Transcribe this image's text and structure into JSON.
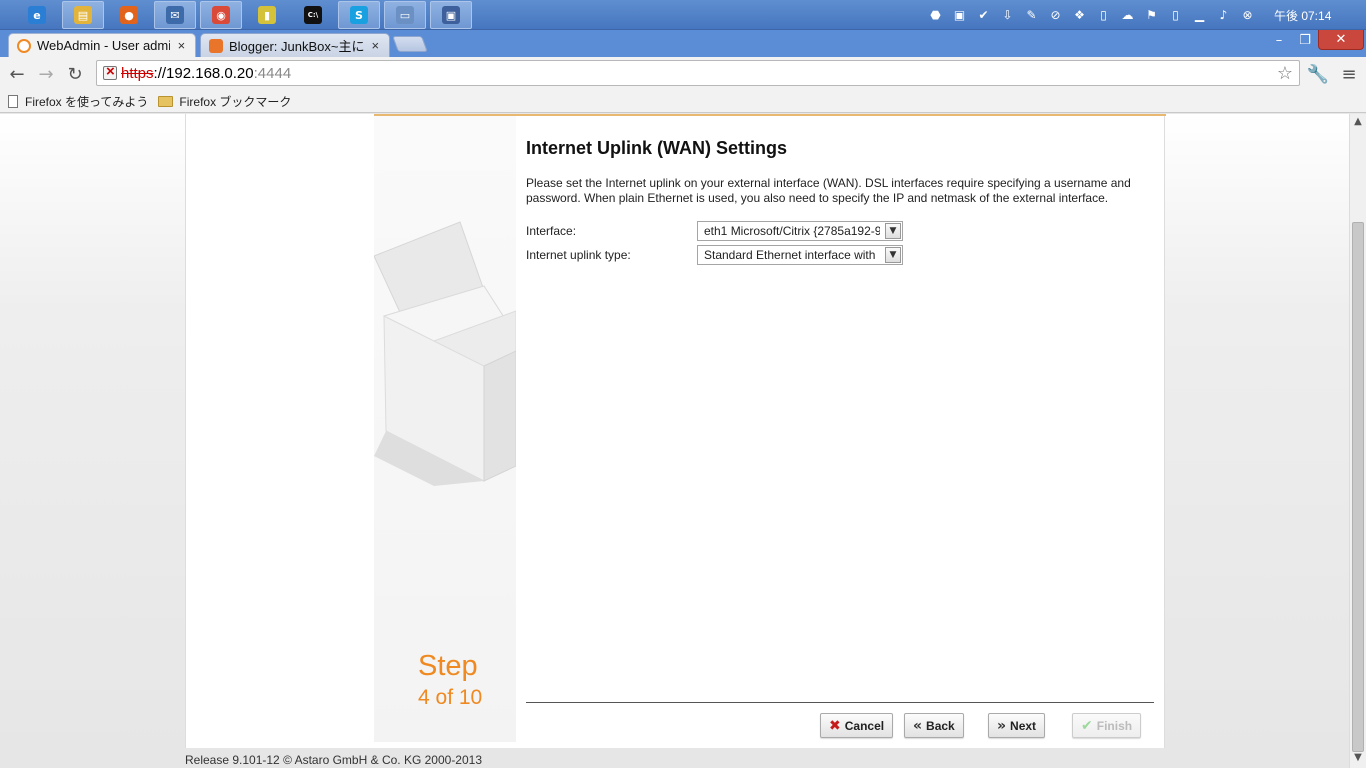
{
  "taskbar": {
    "apps": [
      {
        "name": "ie-icon",
        "glyph": "e",
        "color": "#2a7fd4"
      },
      {
        "name": "file-explorer-icon",
        "glyph": "▤",
        "color": "#e3b43c"
      },
      {
        "name": "firefox-icon",
        "glyph": "●",
        "color": "#e2631b"
      },
      {
        "name": "thunderbird-icon",
        "glyph": "✉",
        "color": "#3d6aa8"
      },
      {
        "name": "chrome-icon",
        "glyph": "◉",
        "color": "#d94a38"
      },
      {
        "name": "notes-icon",
        "glyph": "▮",
        "color": "#d4c23a"
      },
      {
        "name": "cmd-icon",
        "glyph": "C:\\",
        "color": "#111111"
      },
      {
        "name": "skype-icon",
        "glyph": "S",
        "color": "#19a0e0"
      },
      {
        "name": "remote-desktop-icon",
        "glyph": "▭",
        "color": "#6a90c4"
      },
      {
        "name": "network-app-icon",
        "glyph": "▣",
        "color": "#3d5f9c"
      }
    ],
    "tray": [
      "⬣",
      "▣",
      "✔",
      "⇩",
      "✎",
      "⊘",
      "❖",
      "▯",
      "☁",
      "⚑",
      "▯",
      "▁",
      "♪",
      "⊗"
    ],
    "clock": "午後 07:14"
  },
  "browser": {
    "tabs": [
      {
        "title": "WebAdmin - User admi",
        "active": true,
        "favicon_color": "#f08a24"
      },
      {
        "title": "Blogger: JunkBox~主に",
        "active": false,
        "favicon_color": "#e8752a"
      }
    ],
    "close_glyph": "×",
    "url": {
      "scheme": "https",
      "rest": "://192.168.0.20",
      "port": ":4444"
    },
    "bookmarks": [
      {
        "label": "Firefox を使ってみよう",
        "type": "page"
      },
      {
        "label": "Firefox ブックマーク",
        "type": "folder"
      }
    ]
  },
  "wizard": {
    "title": "Internet Uplink (WAN) Settings",
    "description": "Please set the Internet uplink on your external interface (WAN). DSL interfaces require specifying a username and password. When plain Ethernet is used, you also need to specify the IP and netmask of the external interface.",
    "fields": {
      "interface": {
        "label": "Interface:",
        "value": "eth1 Microsoft/Citrix {2785a192-9"
      },
      "uplink_type": {
        "label": "Internet uplink type:",
        "value": "Standard Ethernet interface with"
      }
    },
    "step": {
      "word": "Step",
      "count": "4 of 10"
    },
    "buttons": {
      "cancel": "Cancel",
      "back": "Back",
      "next": "Next",
      "finish": "Finish"
    }
  },
  "footer": "Release 9.101-12  © Astaro GmbH & Co. KG 2000-2013"
}
